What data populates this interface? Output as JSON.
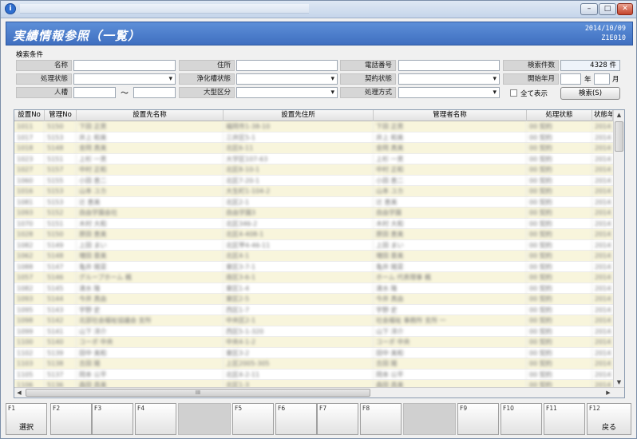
{
  "header": {
    "title": "実績情報参照（一覧）",
    "date": "2014/10/09",
    "screen_id": "Z1E010"
  },
  "search": {
    "caption": "検索条件",
    "labels": {
      "name": "名称",
      "address": "住所",
      "phone": "電話番号",
      "count": "検索件数",
      "status": "処理状態",
      "tank_status": "浄化槽状態",
      "contract_status": "契約状態",
      "start_month": "開始年月",
      "persons": "人槽",
      "large_class": "大型区分",
      "method": "処理方式"
    },
    "count_value": "4328 件",
    "year_unit": "年",
    "month_unit": "月",
    "tilde": "～",
    "show_all_label": "全て表示",
    "search_button": "検索(S)"
  },
  "grid": {
    "columns": [
      "設置No",
      "管理No",
      "設置先名称",
      "設置先住所",
      "管理者名称",
      "処理状態",
      "状態年"
    ],
    "rows": [
      [
        "1011",
        "5150",
        "下田 正男",
        "福岡市1-38-10",
        "下田 正男",
        "00 契約",
        "2014"
      ],
      [
        "1017",
        "5153",
        "井上 和美",
        "三井区5-1",
        "井上 和美",
        "00 契約",
        "2014"
      ],
      [
        "1018",
        "5148",
        "金岡 真美",
        "北区6-11",
        "金岡 真美",
        "00 契約",
        "2014"
      ],
      [
        "1023",
        "5151",
        "上杉 一男",
        "大学区107-63",
        "上杉 一男",
        "00 契約",
        "2014"
      ],
      [
        "1027",
        "5157",
        "中村 正和",
        "北区8-10-1",
        "中村 正和",
        "00 契約",
        "2014"
      ],
      [
        "1060",
        "5155",
        "小田 恵二",
        "北区7-20-1",
        "小田 恵二",
        "00 契約",
        "2014"
      ],
      [
        "1016",
        "5153",
        "山本 ユカ",
        "大生町1-104-2",
        "山本 ユカ",
        "00 契約",
        "2014"
      ],
      [
        "1081",
        "5153",
        "辻 恵美",
        "北区2-1",
        "辻 恵美",
        "00 契約",
        "2014"
      ],
      [
        "1093",
        "5152",
        "自由学園会社",
        "自由学園3",
        "自由学園",
        "00 契約",
        "2014"
      ],
      [
        "1070",
        "5151",
        "木村 大和",
        "北区346-2",
        "木村 大和",
        "00 契約",
        "2014"
      ],
      [
        "1028",
        "5150",
        "原田 恵美",
        "北区4-408-1",
        "原田 恵美",
        "00 契約",
        "2014"
      ],
      [
        "1082",
        "5149",
        "上田 まい",
        "北区甲4-46-11",
        "上田 まい",
        "00 契約",
        "2014"
      ],
      [
        "1062",
        "5148",
        "増田 亜美",
        "北区4-1",
        "増田 亜美",
        "00 契約",
        "2014"
      ],
      [
        "1088",
        "5147",
        "亀井 陽菜",
        "東区3-7-1",
        "亀井 陽菜",
        "00 契約",
        "2014"
      ],
      [
        "1057",
        "5146",
        "グループホーム 楓",
        "南区3-6-1",
        "ホーム 代表理事 楓",
        "00 契約",
        "2014"
      ],
      [
        "1082",
        "5145",
        "清水 隆",
        "東区1-4",
        "清水 隆",
        "00 契約",
        "2014"
      ],
      [
        "1093",
        "5144",
        "今井 真由",
        "東区2-5",
        "今井 真由",
        "00 契約",
        "2014"
      ],
      [
        "1095",
        "5143",
        "宇野 史",
        "西区1-7",
        "宇野 史",
        "00 契約",
        "2014"
      ],
      [
        "1098",
        "5142",
        "北部社会福祉協議会 支所",
        "中央区2-1",
        "社会福祉 事務所 支所 一",
        "00 契約",
        "2014"
      ],
      [
        "1099",
        "5141",
        "山下 洋介",
        "西区5-1-320",
        "山下 洋介",
        "00 契約",
        "2014"
      ],
      [
        "1100",
        "5140",
        "コーポ 中央",
        "中央4-1-2",
        "コーポ 中央",
        "00 契約",
        "2014"
      ],
      [
        "1102",
        "5139",
        "田中 美和",
        "東区3-2",
        "田中 美和",
        "00 契約",
        "2014"
      ],
      [
        "1103",
        "5138",
        "吉田 陽",
        "上区2005-305",
        "吉田 陽",
        "00 契約",
        "2014"
      ],
      [
        "1105",
        "5137",
        "岡本 公平",
        "北区4-2-11",
        "岡本 公平",
        "00 契約",
        "2014"
      ],
      [
        "1106",
        "5136",
        "森田 昌美",
        "北区1-3",
        "森田 昌美",
        "00 契約",
        "2014"
      ]
    ],
    "hscroll_grip": "III"
  },
  "fkeys": [
    {
      "num": "F1",
      "label": "選択"
    },
    {
      "num": "F2",
      "label": ""
    },
    {
      "num": "F3",
      "label": ""
    },
    {
      "num": "F4",
      "label": ""
    },
    {
      "num": "F5",
      "label": ""
    },
    {
      "num": "F6",
      "label": ""
    },
    {
      "num": "F7",
      "label": ""
    },
    {
      "num": "F8",
      "label": ""
    },
    {
      "num": "F9",
      "label": ""
    },
    {
      "num": "F10",
      "label": ""
    },
    {
      "num": "F11",
      "label": ""
    },
    {
      "num": "F12",
      "label": "戻る"
    }
  ]
}
